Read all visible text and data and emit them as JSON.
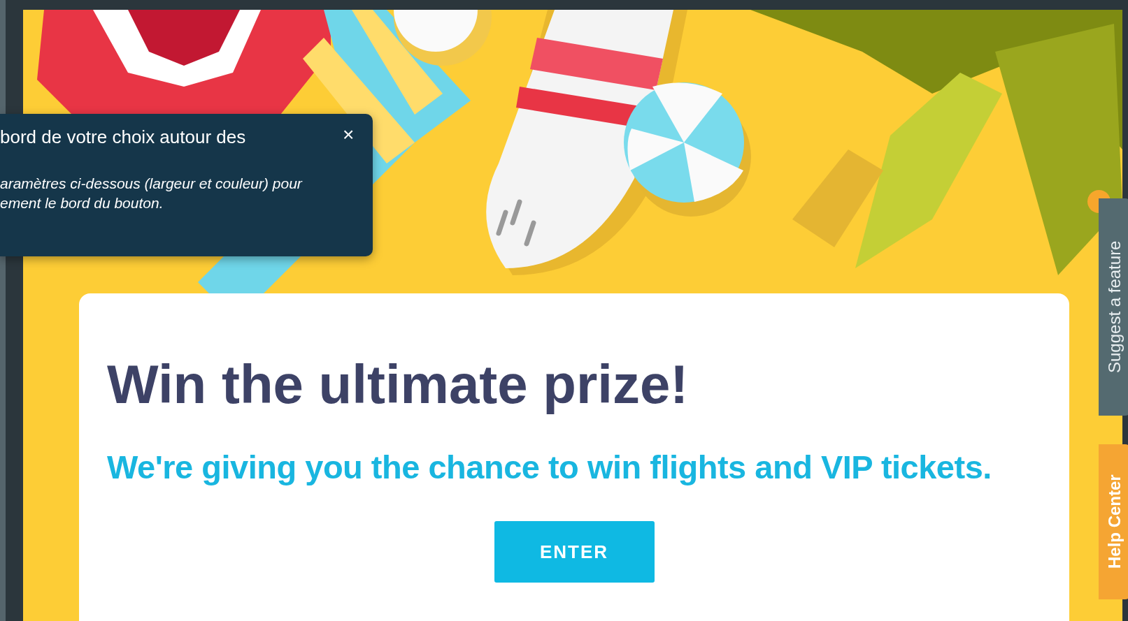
{
  "tooltip": {
    "title": "bord de votre choix autour des",
    "close": "×",
    "body": "aramètres ci-dessous (largeur et couleur) pour\nement le bord du bouton."
  },
  "card": {
    "heading": "Win the ultimate prize!",
    "subheading": "We're giving you the chance to win flights and VIP tickets.",
    "button": "ENTER"
  },
  "side_tabs": [
    {
      "kind": "suggest",
      "label": "Suggest a feature"
    },
    {
      "kind": "help",
      "label": "Help Center"
    }
  ]
}
